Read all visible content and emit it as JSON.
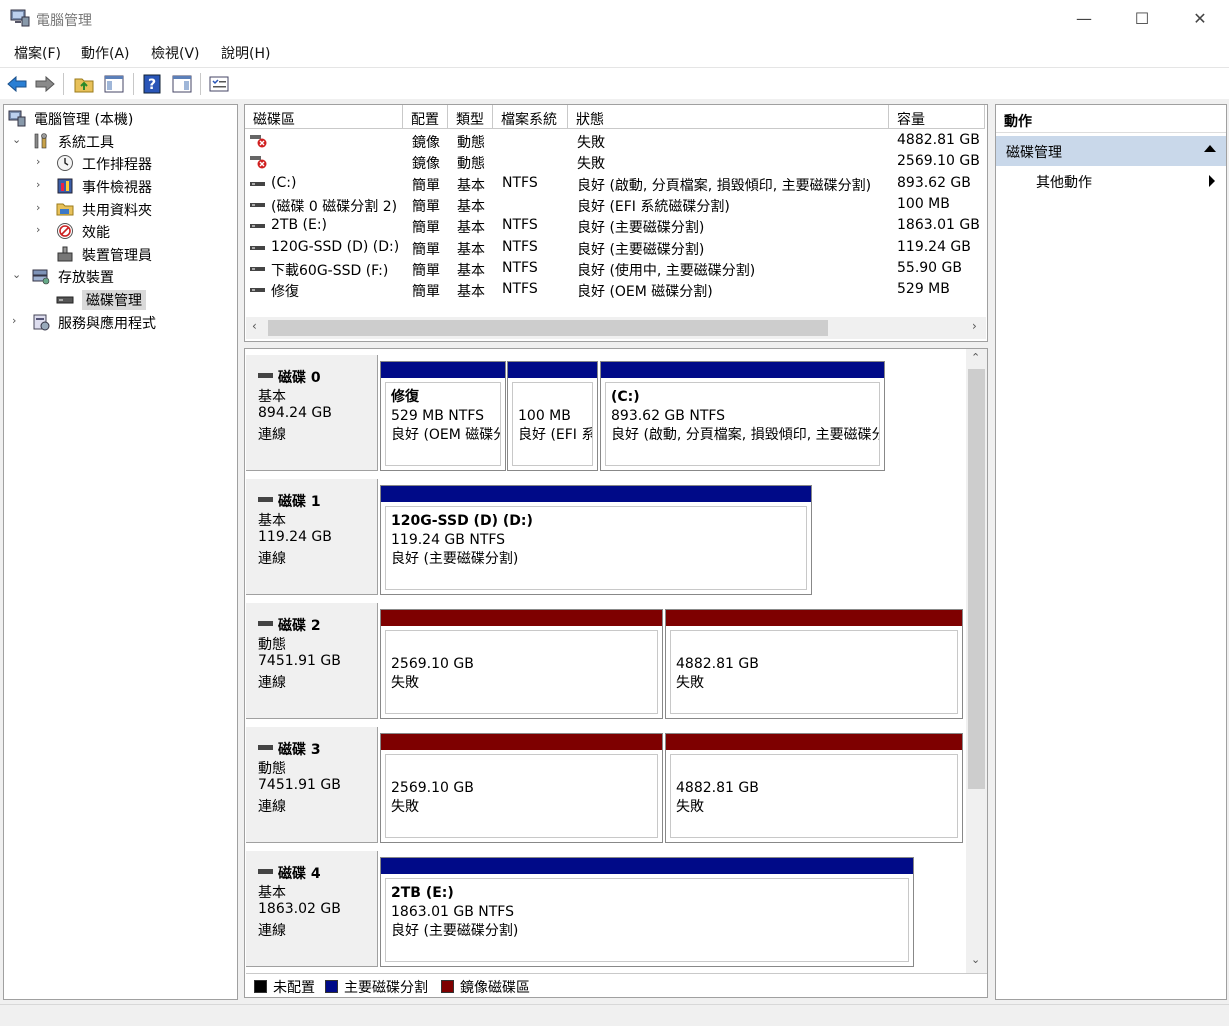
{
  "window": {
    "title": "電腦管理",
    "minimize": "—",
    "maximize": "☐",
    "close": "✕"
  },
  "menu": [
    "檔案(F)",
    "動作(A)",
    "檢視(V)",
    "說明(H)"
  ],
  "tree": {
    "root": "電腦管理 (本機)",
    "system_tools": "系統工具",
    "task_scheduler": "工作排程器",
    "event_viewer": "事件檢視器",
    "shared_folders": "共用資料夾",
    "performance": "效能",
    "device_manager": "裝置管理員",
    "storage": "存放裝置",
    "disk_management": "磁碟管理",
    "services_apps": "服務與應用程式"
  },
  "columns": [
    "磁碟區",
    "配置",
    "類型",
    "檔案系統",
    "狀態",
    "容量"
  ],
  "volumes": [
    {
      "name": "",
      "layout": "鏡像",
      "type": "動態",
      "fs": "",
      "status": "失敗",
      "capacity": "4882.81 GB",
      "icon": "failed-volume-icon"
    },
    {
      "name": "",
      "layout": "鏡像",
      "type": "動態",
      "fs": "",
      "status": "失敗",
      "capacity": "2569.10 GB",
      "icon": "failed-volume-icon"
    },
    {
      "name": "(C:)",
      "layout": "簡單",
      "type": "基本",
      "fs": "NTFS",
      "status": "良好 (啟動, 分頁檔案, 損毀傾印, 主要磁碟分割)",
      "capacity": "893.62 GB",
      "icon": "volume-icon"
    },
    {
      "name": "(磁碟 0 磁碟分割 2)",
      "layout": "簡單",
      "type": "基本",
      "fs": "",
      "status": "良好 (EFI 系統磁碟分割)",
      "capacity": "100 MB",
      "icon": "volume-icon"
    },
    {
      "name": "2TB (E:)",
      "layout": "簡單",
      "type": "基本",
      "fs": "NTFS",
      "status": "良好 (主要磁碟分割)",
      "capacity": "1863.01 GB",
      "icon": "volume-icon"
    },
    {
      "name": "120G-SSD (D) (D:)",
      "layout": "簡單",
      "type": "基本",
      "fs": "NTFS",
      "status": "良好 (主要磁碟分割)",
      "capacity": "119.24 GB",
      "icon": "volume-icon"
    },
    {
      "name": "下載60G-SSD (F:)",
      "layout": "簡單",
      "type": "基本",
      "fs": "NTFS",
      "status": "良好 (使用中, 主要磁碟分割)",
      "capacity": "55.90 GB",
      "icon": "volume-icon"
    },
    {
      "name": "修復",
      "layout": "簡單",
      "type": "基本",
      "fs": "NTFS",
      "status": "良好 (OEM 磁碟分割)",
      "capacity": "529 MB",
      "icon": "volume-icon"
    }
  ],
  "scroll": {
    "left": "‹",
    "right": "›",
    "up": "⌃",
    "down": "⌄"
  },
  "disks": [
    {
      "name": "磁碟 0",
      "type": "基本",
      "size": "894.24 GB",
      "state": "連線",
      "partitions": [
        {
          "name": "修復",
          "l1": "529 MB NTFS",
          "l2": "良好 (OEM 磁碟分割)",
          "color": "#000a88"
        },
        {
          "name": "",
          "l1": "100 MB",
          "l2": "良好 (EFI 系統磁碟分割)",
          "color": "#000a88"
        },
        {
          "name": "(C:)",
          "l1": "893.62 GB NTFS",
          "l2": "良好 (啟動, 分頁檔案, 損毀傾印, 主要磁碟分割)",
          "color": "#000a88"
        }
      ]
    },
    {
      "name": "磁碟 1",
      "type": "基本",
      "size": "119.24 GB",
      "state": "連線",
      "partitions": [
        {
          "name": "120G-SSD (D)  (D:)",
          "l1": "119.24 GB NTFS",
          "l2": "良好 (主要磁碟分割)",
          "color": "#000a88"
        }
      ]
    },
    {
      "name": "磁碟 2",
      "type": "動態",
      "size": "7451.91 GB",
      "state": "連線",
      "partitions": [
        {
          "name": "",
          "l1": "2569.10 GB",
          "l2": "失敗",
          "color": "#7e0000"
        },
        {
          "name": "",
          "l1": "4882.81 GB",
          "l2": "失敗",
          "color": "#7e0000"
        }
      ]
    },
    {
      "name": "磁碟 3",
      "type": "動態",
      "size": "7451.91 GB",
      "state": "連線",
      "partitions": [
        {
          "name": "",
          "l1": "2569.10 GB",
          "l2": "失敗",
          "color": "#7e0000"
        },
        {
          "name": "",
          "l1": "4882.81 GB",
          "l2": "失敗",
          "color": "#7e0000"
        }
      ]
    },
    {
      "name": "磁碟 4",
      "type": "基本",
      "size": "1863.02 GB",
      "state": "連線",
      "partitions": [
        {
          "name": "2TB  (E:)",
          "l1": "1863.01 GB NTFS",
          "l2": "良好 (主要磁碟分割)",
          "color": "#000a88"
        }
      ]
    }
  ],
  "legend": [
    {
      "label": "未配置",
      "color": "#000000"
    },
    {
      "label": "主要磁碟分割",
      "color": "#000a88"
    },
    {
      "label": "鏡像磁碟區",
      "color": "#7e0000"
    }
  ],
  "actions": {
    "title": "動作",
    "section": "磁碟管理",
    "more": "其他動作"
  }
}
